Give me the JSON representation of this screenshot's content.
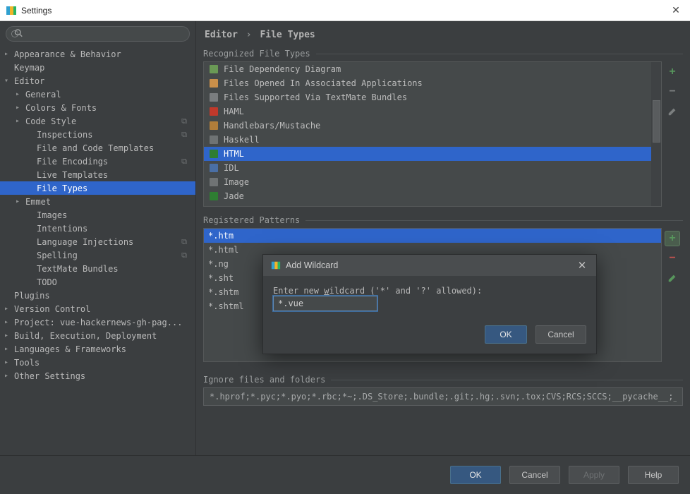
{
  "window": {
    "title": "Settings"
  },
  "sidebar": {
    "search_placeholder": "",
    "items": [
      {
        "label": "Appearance & Behavior",
        "level": "top",
        "state": "collapsed"
      },
      {
        "label": "Keymap",
        "level": "top",
        "state": "leaf"
      },
      {
        "label": "Editor",
        "level": "top",
        "state": "expanded"
      },
      {
        "label": "General",
        "level": "lvl1",
        "state": "collapsed"
      },
      {
        "label": "Colors & Fonts",
        "level": "lvl1",
        "state": "collapsed"
      },
      {
        "label": "Code Style",
        "level": "lvl1",
        "state": "collapsed",
        "trail": true
      },
      {
        "label": "Inspections",
        "level": "lvl2",
        "state": "leaf",
        "trail": true
      },
      {
        "label": "File and Code Templates",
        "level": "lvl2",
        "state": "leaf"
      },
      {
        "label": "File Encodings",
        "level": "lvl2",
        "state": "leaf",
        "trail": true
      },
      {
        "label": "Live Templates",
        "level": "lvl2",
        "state": "leaf"
      },
      {
        "label": "File Types",
        "level": "lvl2",
        "state": "leaf",
        "selected": true
      },
      {
        "label": "Emmet",
        "level": "lvl1",
        "state": "collapsed"
      },
      {
        "label": "Images",
        "level": "lvl2",
        "state": "leaf"
      },
      {
        "label": "Intentions",
        "level": "lvl2",
        "state": "leaf"
      },
      {
        "label": "Language Injections",
        "level": "lvl2",
        "state": "leaf",
        "trail": true
      },
      {
        "label": "Spelling",
        "level": "lvl2",
        "state": "leaf",
        "trail": true
      },
      {
        "label": "TextMate Bundles",
        "level": "lvl2",
        "state": "leaf"
      },
      {
        "label": "TODO",
        "level": "lvl2",
        "state": "leaf"
      },
      {
        "label": "Plugins",
        "level": "top",
        "state": "leaf"
      },
      {
        "label": "Version Control",
        "level": "top",
        "state": "collapsed"
      },
      {
        "label": "Project: vue-hackernews-gh-pag...",
        "level": "top",
        "state": "collapsed"
      },
      {
        "label": "Build, Execution, Deployment",
        "level": "top",
        "state": "collapsed"
      },
      {
        "label": "Languages & Frameworks",
        "level": "top",
        "state": "collapsed"
      },
      {
        "label": "Tools",
        "level": "top",
        "state": "collapsed"
      },
      {
        "label": "Other Settings",
        "level": "top",
        "state": "collapsed"
      }
    ]
  },
  "breadcrumb": {
    "root": "Editor",
    "leaf": "File Types"
  },
  "sections": {
    "recognized": "Recognized File Types",
    "patterns": "Registered Patterns",
    "ignore": "Ignore files and folders"
  },
  "filetypes": [
    {
      "label": "File Dependency Diagram",
      "icon_bg": "#6a9955",
      "icon_fg": "#fff"
    },
    {
      "label": "Files Opened In Associated Applications",
      "icon_bg": "#c98f4a",
      "icon_fg": "#fff"
    },
    {
      "label": "Files Supported Via TextMate Bundles",
      "icon_bg": "#7a7d7f",
      "icon_fg": "#fff"
    },
    {
      "label": "HAML",
      "icon_bg": "#c0392b",
      "icon_fg": "#fff"
    },
    {
      "label": "Handlebars/Mustache",
      "icon_bg": "#b07d3a",
      "icon_fg": "#fff"
    },
    {
      "label": "Haskell",
      "icon_bg": "#6f7374",
      "icon_fg": "#fff"
    },
    {
      "label": "HTML",
      "icon_bg": "#2e7d32",
      "icon_fg": "#fff",
      "selected": true
    },
    {
      "label": "IDL",
      "icon_bg": "#4a6fa5",
      "icon_fg": "#fff"
    },
    {
      "label": "Image",
      "icon_bg": "#6f7374",
      "icon_fg": "#fff"
    },
    {
      "label": "Jade",
      "icon_bg": "#2e7d32",
      "icon_fg": "#fff"
    }
  ],
  "patterns": [
    {
      "label": "*.htm",
      "selected": true
    },
    {
      "label": "*.html"
    },
    {
      "label": "*.ng"
    },
    {
      "label": "*.sht"
    },
    {
      "label": "*.shtm"
    },
    {
      "label": "*.shtml"
    }
  ],
  "ignore_value": "*.hprof;*.pyc;*.pyo;*.rbc;*~;.DS_Store;.bundle;.git;.hg;.svn;.tox;CVS;RCS;SCCS;__pycache__;_sv",
  "buttons": {
    "ok": "OK",
    "cancel": "Cancel",
    "apply": "Apply",
    "help": "Help"
  },
  "modal": {
    "title": "Add Wildcard",
    "label_pre": "Enter new ",
    "label_under": "w",
    "label_post": "ildcard ('*' and '?' allowed):",
    "value": "*.vue",
    "ok": "OK",
    "cancel": "Cancel"
  }
}
